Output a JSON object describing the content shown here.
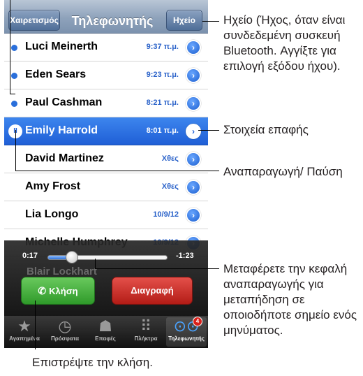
{
  "navbar": {
    "back_label": "Χαιρετισμός",
    "title": "Τηλεφωνητής",
    "speaker_label": "Ηχείο"
  },
  "messages": [
    {
      "name": "Luci Meinerth",
      "time": "9:37 π.μ.",
      "unheard": true
    },
    {
      "name": "Eden Sears",
      "time": "9:23 π.μ.",
      "unheard": true
    },
    {
      "name": "Paul Cashman",
      "time": "8:21 π.μ.",
      "unheard": true
    },
    {
      "name": "Emily Harrold",
      "time": "8:01 π.μ.",
      "selected": true
    },
    {
      "name": "David Martinez",
      "time": "Χθες"
    },
    {
      "name": "Amy Frost",
      "time": "Χθες"
    },
    {
      "name": "Lia Longo",
      "time": "10/9/12"
    },
    {
      "name": "Michelle Humphrey",
      "time": "10/9/12"
    }
  ],
  "player": {
    "elapsed": "0:17",
    "remaining": "-1:23",
    "progress": 0.2,
    "partial_row_name": "Blair Lockhart",
    "call_label": "Κλήση",
    "delete_label": "Διαγραφή"
  },
  "tabs": [
    {
      "label": "Αγαπημένα",
      "icon": "star-icon"
    },
    {
      "label": "Πρόσφατα",
      "icon": "clock-icon"
    },
    {
      "label": "Επαφές",
      "icon": "contacts-icon"
    },
    {
      "label": "Πλήκτρα",
      "icon": "keypad-icon"
    },
    {
      "label": "Τηλεφωνητής",
      "icon": "voicemail-icon",
      "active": true,
      "badge": "4"
    }
  ],
  "callouts": {
    "speaker": "Ηχείο (Ήχος, όταν είναι συνδεδεμένη συσκευή Bluetooth. Αγγίξτε για επιλογή εξόδου ήχου).",
    "contact_info": "Στοιχεία επαφής",
    "play_pause": "Αναπαραγωγή/ Παύση",
    "scrubber": "Μεταφέρετε την κεφαλή αναπαραγωγής για μεταπήδηση σε οποιοδήποτε σημείο ενός μηνύματος.",
    "call_back": "Επιστρέψτε την κλήση."
  },
  "colors": {
    "selected_row": "#1f5fd6",
    "unheard_dot": "#2a6fdb",
    "call_button": "#2f9a2a",
    "delete_button": "#b31c16",
    "badge": "#d8201a"
  }
}
